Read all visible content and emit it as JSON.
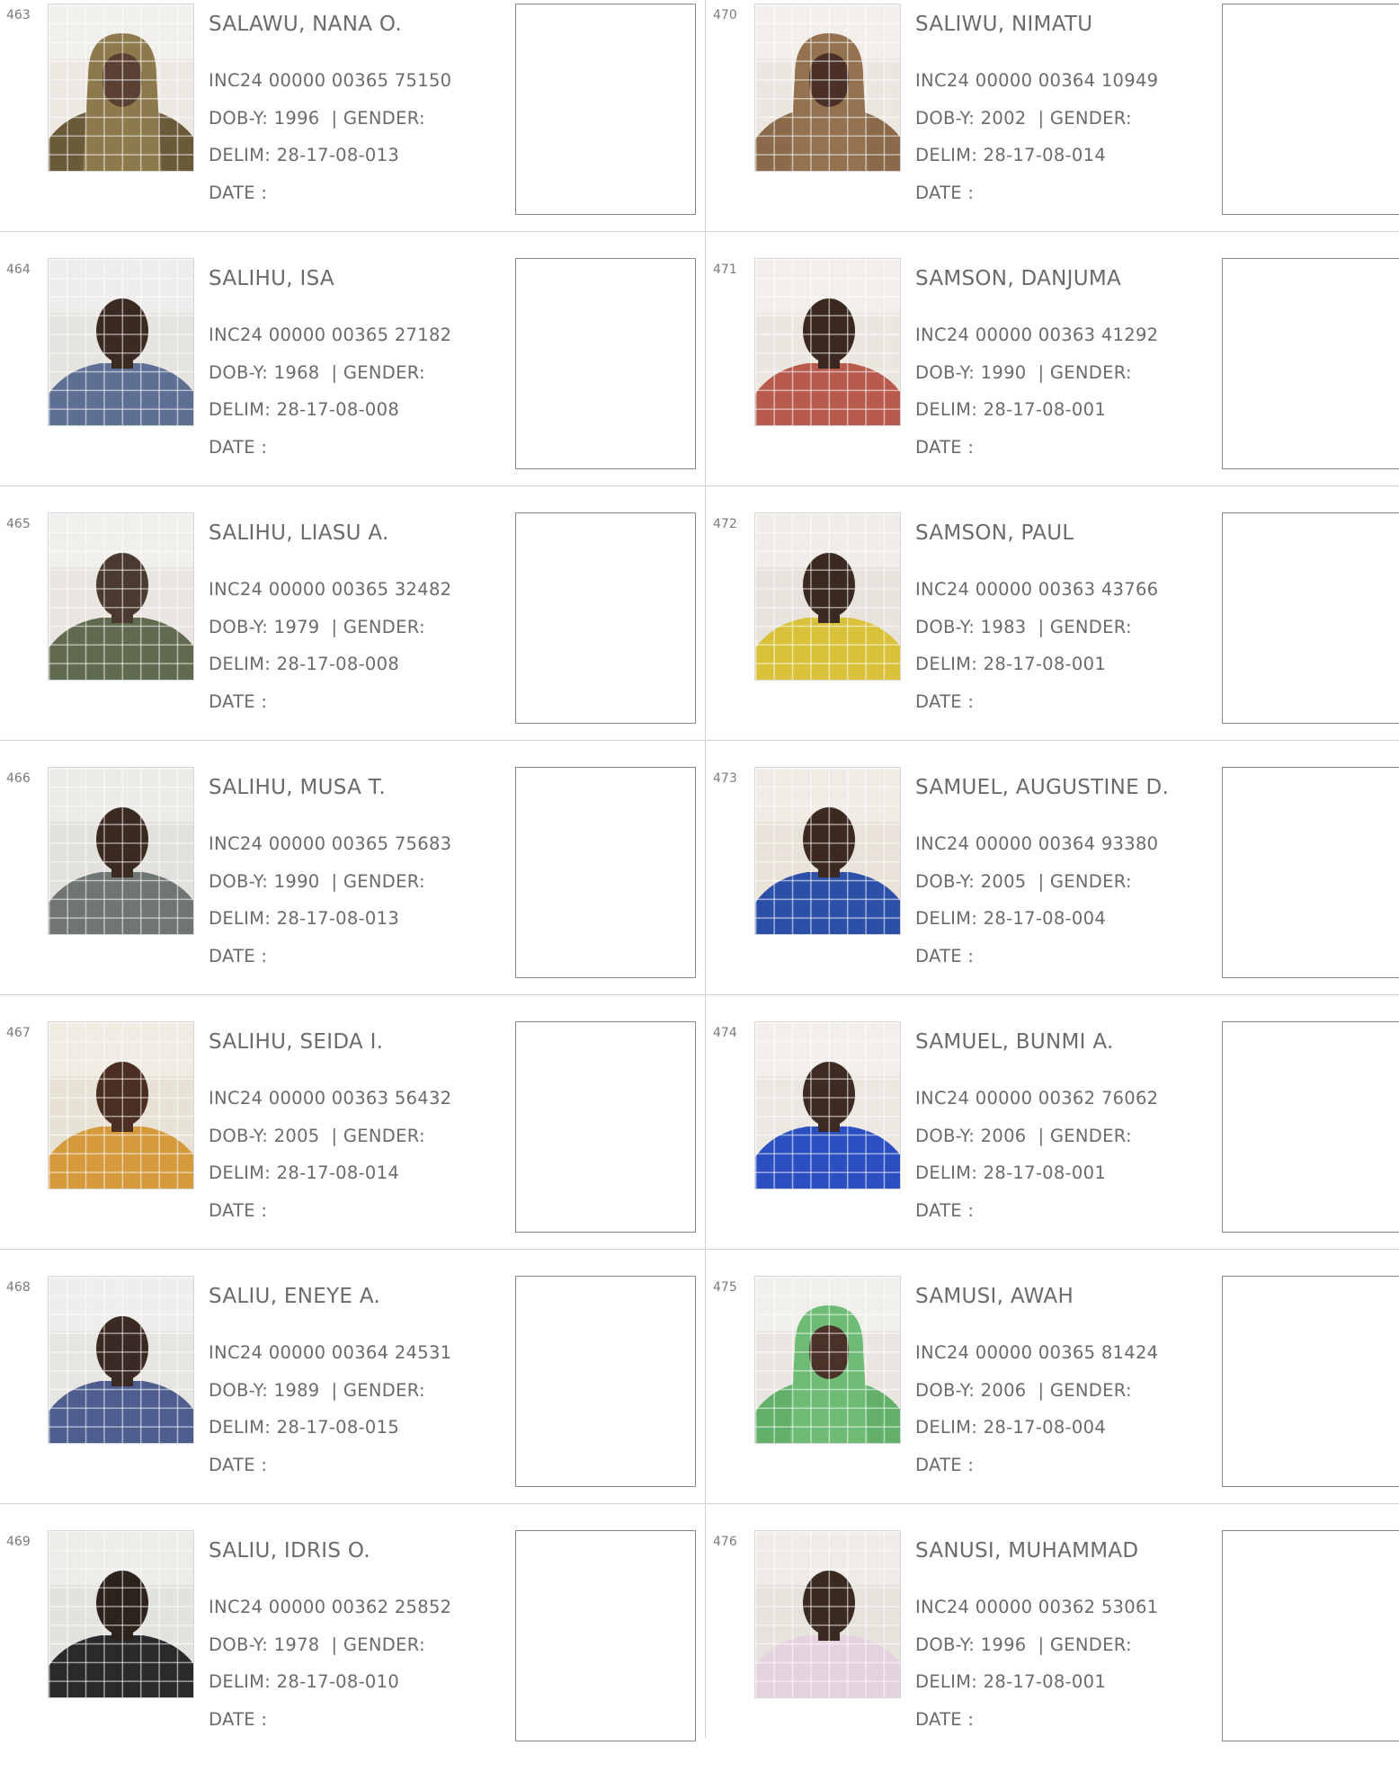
{
  "records": [
    {
      "serial": "463",
      "name": "SALAWU, NANA O.",
      "inc": "INC24 00000 00365 75150",
      "dob_year": "1996",
      "delim": "28-17-08-013",
      "photo": {
        "bg": "#ece8e2",
        "skin": "#5a4032",
        "cloth": "#6b5a3a",
        "scarf": "#8d7a4c"
      }
    },
    {
      "serial": "464",
      "name": "SALIHU, ISA",
      "inc": "INC24 00000 00365 27182",
      "dob_year": "1968",
      "delim": "28-17-08-008",
      "photo": {
        "bg": "#e6e4e0",
        "skin": "#3a2a22",
        "cloth": "#5d6f93"
      }
    },
    {
      "serial": "465",
      "name": "SALIHU, LIASU A.",
      "inc": "INC24 00000 00365 32482",
      "dob_year": "1979",
      "delim": "28-17-08-008",
      "photo": {
        "bg": "#e9e6e2",
        "skin": "#4a3a30",
        "cloth": "#5f6a4e"
      }
    },
    {
      "serial": "466",
      "name": "SALIHU, MUSA T.",
      "inc": "INC24 00000 00365 75683",
      "dob_year": "1990",
      "delim": "28-17-08-013",
      "photo": {
        "bg": "#e3e1dc",
        "skin": "#3b2a22",
        "cloth": "#6f7573"
      }
    },
    {
      "serial": "467",
      "name": "SALIHU, SEIDA I.",
      "inc": "INC24 00000 00363 56432",
      "dob_year": "2005",
      "delim": "28-17-08-014",
      "photo": {
        "bg": "#e8e2d6",
        "skin": "#4a2f22",
        "cloth": "#d49a3c"
      }
    },
    {
      "serial": "468",
      "name": "SALIU, ENEYE A.",
      "inc": "INC24 00000 00364 24531",
      "dob_year": "1989",
      "delim": "28-17-08-015",
      "photo": {
        "bg": "#e7e5e2",
        "skin": "#3b2a23",
        "cloth": "#4c5d8e"
      }
    },
    {
      "serial": "469",
      "name": "SALIU, IDRIS O.",
      "inc": "INC24 00000 00362 25852",
      "dob_year": "1978",
      "delim": "28-17-08-010",
      "photo": {
        "bg": "#e4e2de",
        "skin": "#2e221d",
        "cloth": "#2a2a2c"
      }
    },
    {
      "serial": "470",
      "name": "SALIWU, NIMATU",
      "inc": "INC24 00000 00364 10949",
      "dob_year": "2002",
      "delim": "28-17-08-014",
      "photo": {
        "bg": "#ebe7e0",
        "skin": "#4a3026",
        "cloth": "#8a6a4a",
        "scarf": "#94714f"
      }
    },
    {
      "serial": "471",
      "name": "SAMSON, DANJUMA",
      "inc": "INC24 00000 00363 41292",
      "dob_year": "1990",
      "delim": "28-17-08-001",
      "photo": {
        "bg": "#ebe6df",
        "skin": "#3a2820",
        "cloth": "#b85a4e"
      }
    },
    {
      "serial": "472",
      "name": "SAMSON, PAUL",
      "inc": "INC24 00000 00363 43766",
      "dob_year": "1983",
      "delim": "28-17-08-001",
      "photo": {
        "bg": "#e8e3dc",
        "skin": "#3a2a22",
        "cloth": "#d9c23a"
      }
    },
    {
      "serial": "473",
      "name": "SAMUEL, AUGUSTINE D.",
      "inc": "INC24 00000 00364 93380",
      "dob_year": "2005",
      "delim": "28-17-08-004",
      "photo": {
        "bg": "#e8e2d8",
        "skin": "#3c2a22",
        "cloth": "#2c4fa8"
      }
    },
    {
      "serial": "474",
      "name": "SAMUEL, BUNMI A.",
      "inc": "INC24 00000 00362 76062",
      "dob_year": "2006",
      "delim": "28-17-08-001",
      "photo": {
        "bg": "#ebe7e1",
        "skin": "#3e2c24",
        "cloth": "#2b4fc0"
      }
    },
    {
      "serial": "475",
      "name": "SAMUSI, AWAH",
      "inc": "INC24 00000 00365 81424",
      "dob_year": "2006",
      "delim": "28-17-08-004",
      "photo": {
        "bg": "#e9e6e1",
        "skin": "#4a3228",
        "cloth": "#62b06a",
        "scarf": "#6dbb74"
      }
    },
    {
      "serial": "476",
      "name": "SANUSI, MUHAMMAD",
      "inc": "INC24 00000 00362 53061",
      "dob_year": "1996",
      "delim": "28-17-08-001",
      "photo": {
        "bg": "#e6e2dc",
        "skin": "#3b2a22",
        "cloth": "#e4d3df"
      }
    }
  ],
  "labels": {
    "dob": "DOB-Y:",
    "gender": "| GENDER:",
    "delim": "DELIM:",
    "date": "DATE  :"
  }
}
